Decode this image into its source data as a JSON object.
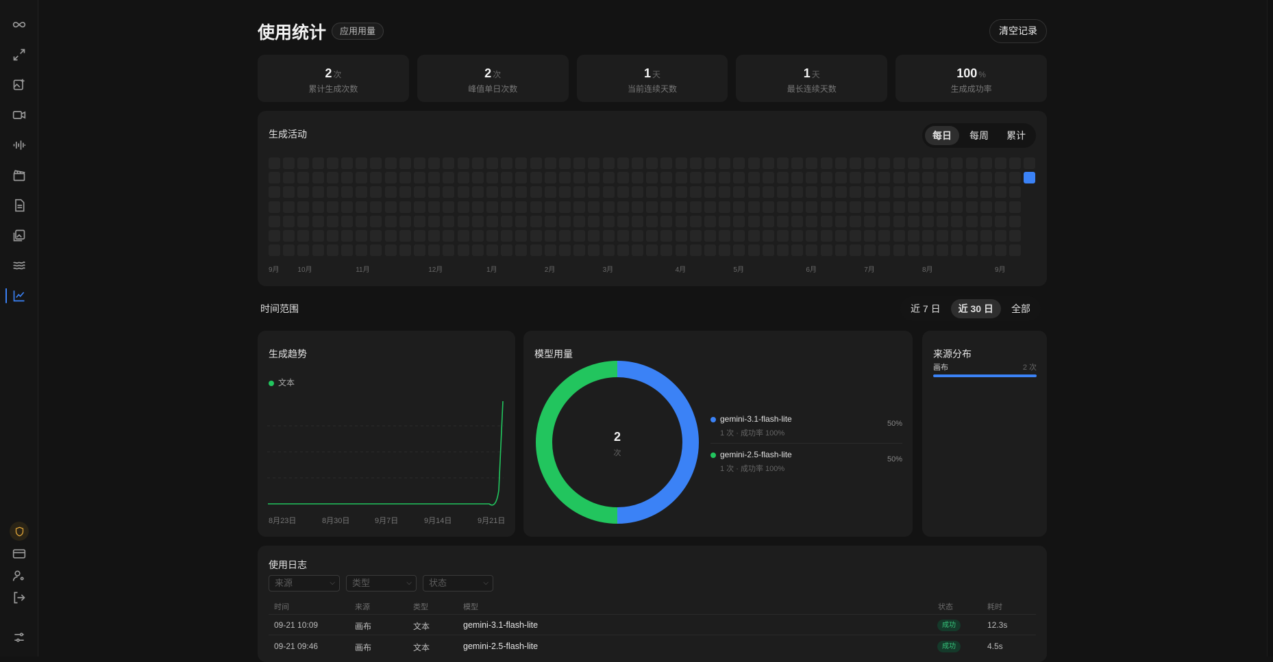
{
  "page": {
    "title": "使用统计",
    "badge": "应用用量",
    "clear_label": "清空记录"
  },
  "stats": [
    {
      "value": "2",
      "unit": "次",
      "label": "累计生成次数"
    },
    {
      "value": "2",
      "unit": "次",
      "label": "峰值单日次数"
    },
    {
      "value": "1",
      "unit": "天",
      "label": "当前连续天数"
    },
    {
      "value": "1",
      "unit": "天",
      "label": "最长连续天数"
    },
    {
      "value": "100",
      "unit": "%",
      "label": "生成成功率"
    }
  ],
  "activity": {
    "title": "生成活动",
    "tabs": [
      "每日",
      "每周",
      "累计"
    ],
    "active_tab": "每日",
    "months": [
      "9月",
      "10月",
      "11月",
      "12月",
      "1月",
      "2月",
      "3月",
      "4月",
      "5月",
      "6月",
      "7月",
      "8月",
      "9月"
    ],
    "accent": "#3b82f6"
  },
  "range": {
    "label": "时间范围",
    "options": [
      "近 7 日",
      "近 30 日",
      "全部"
    ],
    "active": "近 30 日"
  },
  "trend": {
    "title": "生成趋势",
    "legend": "文本",
    "color": "#22c55e",
    "xlabels": [
      "8月23日",
      "8月30日",
      "9月7日",
      "9月14日",
      "9月21日"
    ]
  },
  "models": {
    "title": "模型用量",
    "center_value": "2",
    "center_unit": "次",
    "items": [
      {
        "name": "gemini-3.1-flash-lite",
        "sub": "1 次 · 成功率 100%",
        "pct": "50%",
        "color": "#3b82f6"
      },
      {
        "name": "gemini-2.5-flash-lite",
        "sub": "1 次 · 成功率 100%",
        "pct": "50%",
        "color": "#22c55e"
      }
    ]
  },
  "sources": {
    "title": "来源分布",
    "items": [
      {
        "name": "画布",
        "count": "2 次"
      }
    ]
  },
  "log": {
    "title": "使用日志",
    "filters": [
      "来源",
      "类型",
      "状态"
    ],
    "columns": [
      "时间",
      "来源",
      "类型",
      "模型",
      "状态",
      "耗时"
    ],
    "rows": [
      {
        "time": "09-21 10:09",
        "source": "画布",
        "type": "文本",
        "model": "gemini-3.1-flash-lite",
        "status": "成功",
        "duration": "12.3s"
      },
      {
        "time": "09-21 09:46",
        "source": "画布",
        "type": "文本",
        "model": "gemini-2.5-flash-lite",
        "status": "成功",
        "duration": "4.5s"
      }
    ]
  },
  "chart_data": [
    {
      "type": "line",
      "title": "生成趋势",
      "x": [
        "8月23日",
        "8月30日",
        "9月7日",
        "9月14日",
        "9月21日"
      ],
      "series": [
        {
          "name": "文本",
          "values": [
            0,
            0,
            0,
            0,
            2
          ]
        }
      ]
    },
    {
      "type": "pie",
      "title": "模型用量",
      "categories": [
        "gemini-3.1-flash-lite",
        "gemini-2.5-flash-lite"
      ],
      "values": [
        1,
        1
      ]
    }
  ]
}
